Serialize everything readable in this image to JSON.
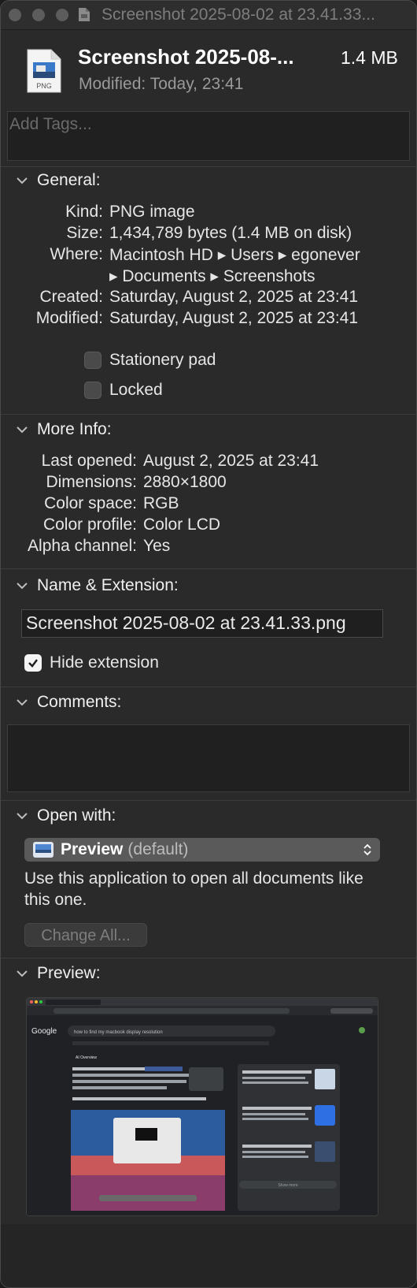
{
  "titlebar": {
    "title": "Screenshot 2025-08-02 at 23.41.33..."
  },
  "header": {
    "file_name": "Screenshot 2025-08-...",
    "file_size": "1.4 MB",
    "modified_label": "Modified:",
    "modified_value": "Today, 23:41",
    "file_type_badge": "PNG"
  },
  "tags": {
    "placeholder": "Add Tags..."
  },
  "general": {
    "heading": "General:",
    "rows": [
      {
        "label": "Kind:",
        "value": "PNG image"
      },
      {
        "label": "Size:",
        "value": "1,434,789 bytes (1.4 MB on disk)"
      },
      {
        "label": "Where:",
        "value": "Macintosh HD ▸ Users ▸ egonever"
      },
      {
        "label": "",
        "value": "▸ Documents ▸ Screenshots"
      },
      {
        "label": "Created:",
        "value": "Saturday, August 2, 2025 at 23:41"
      },
      {
        "label": "Modified:",
        "value": "Saturday, August 2, 2025 at 23:41"
      }
    ],
    "stationery_label": "Stationery pad",
    "locked_label": "Locked"
  },
  "more_info": {
    "heading": "More Info:",
    "rows": [
      {
        "label": "Last opened:",
        "value": "August 2, 2025 at 23:41"
      },
      {
        "label": "Dimensions:",
        "value": "2880×1800"
      },
      {
        "label": "Color space:",
        "value": "RGB"
      },
      {
        "label": "Color profile:",
        "value": "Color LCD"
      },
      {
        "label": "Alpha channel:",
        "value": "Yes"
      }
    ]
  },
  "name_extension": {
    "heading": "Name & Extension:",
    "file_name_value": "Screenshot 2025-08-02 at 23.41.33.png",
    "hide_extension_label": "Hide extension",
    "hide_extension_checked": true
  },
  "comments": {
    "heading": "Comments:"
  },
  "open_with": {
    "heading": "Open with:",
    "app_name": "Preview",
    "app_default": "(default)",
    "description": "Use this application to open all documents like this one.",
    "change_all_label": "Change All..."
  },
  "preview": {
    "heading": "Preview:",
    "thumb": {
      "search_logo": "Google",
      "query": "how to find my macbook display resolution",
      "ai_overview_label": "AI Overview",
      "show_more": "Show more"
    }
  },
  "colors": {
    "window_bg": "#2a2a2a",
    "checkbox_checked": "#f5f5f5",
    "popup_bg": "#5a5a5a",
    "label_dim": "#9a9a9a"
  }
}
